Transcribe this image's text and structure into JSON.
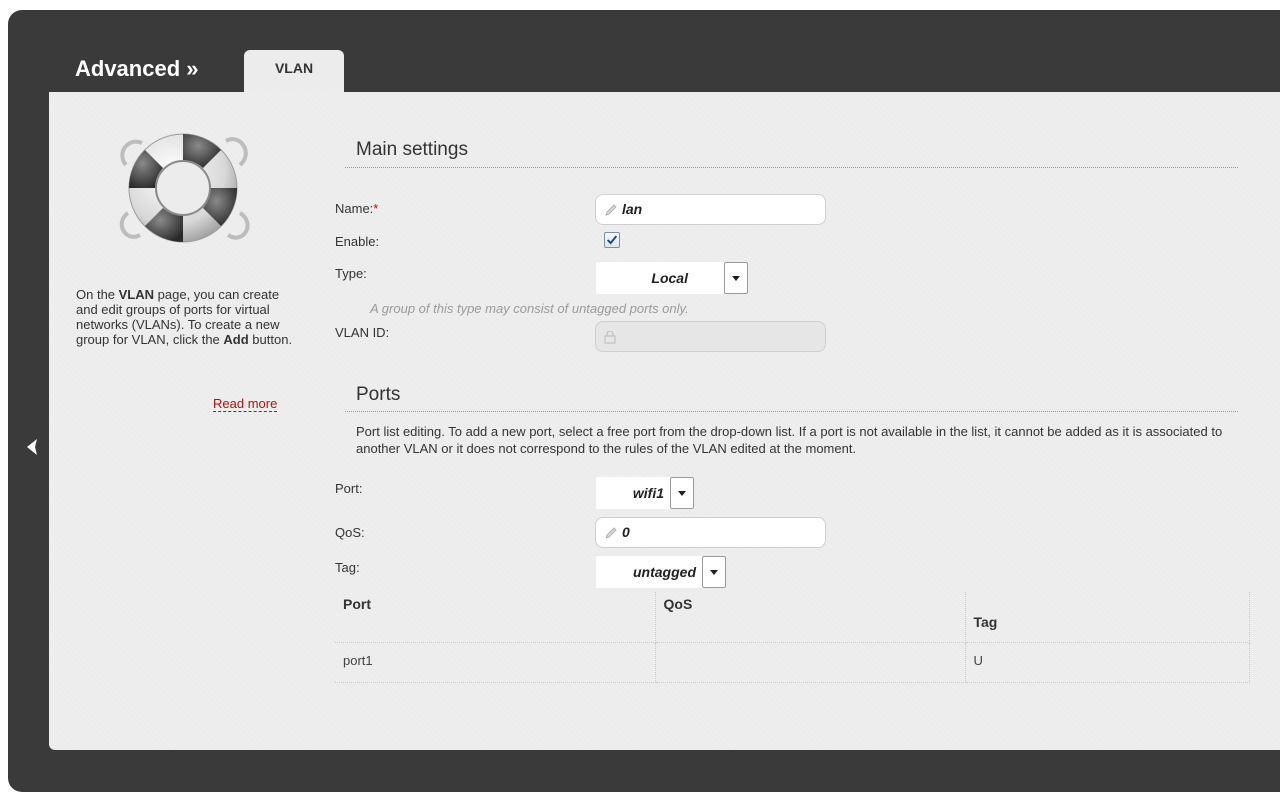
{
  "header": {
    "breadcrumb": "Advanced »",
    "tab_label": "VLAN"
  },
  "sidebar": {
    "help_parts": [
      "On the ",
      "VLAN",
      " page, you can create and edit groups of ports for virtual networks (VLANs). To create a new group for VLAN, click the ",
      "Add",
      " button."
    ],
    "read_more": "Read more",
    "icon": "lifebuoy-icon"
  },
  "main_settings": {
    "title": "Main settings",
    "name_label": "Name:",
    "name_required": "*",
    "name_value": "lan",
    "enable_label": "Enable:",
    "enable_checked": true,
    "type_label": "Type:",
    "type_value": "Local",
    "type_hint": "A group of this type may consist of untagged ports only.",
    "vlan_id_label": "VLAN ID:",
    "vlan_id_value": ""
  },
  "ports": {
    "title": "Ports",
    "description": "Port list editing. To add a new port, select a free port from the drop-down list. If a port is not available in the list, it cannot be added as it is associated to another VLAN or it does not correspond to the rules of the VLAN edited at the moment.",
    "port_label": "Port:",
    "port_value": "wifi1",
    "qos_label": "QoS:",
    "qos_value": "0",
    "tag_label": "Tag:",
    "tag_value": "untagged",
    "table": {
      "headers": [
        "Port",
        "QoS",
        "Tag"
      ],
      "rows": [
        [
          "port1",
          "",
          "U"
        ]
      ]
    }
  },
  "colors": {
    "frame": "#3a3a3a",
    "panel": "#ececec",
    "link": "#b01010",
    "required": "#e00000"
  }
}
